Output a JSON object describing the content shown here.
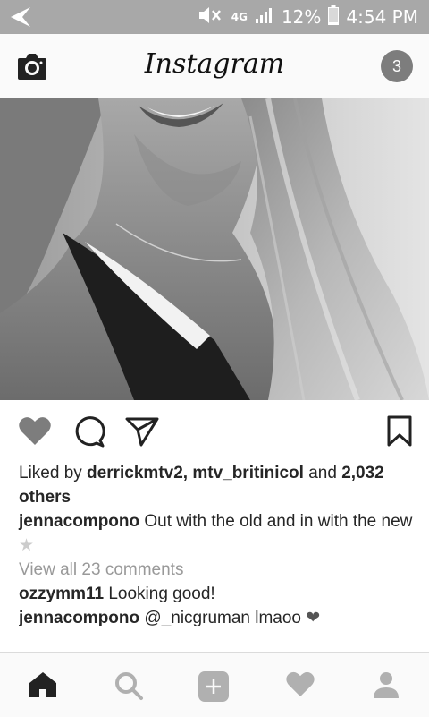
{
  "status_bar": {
    "battery": "12%",
    "time": "4:54 PM",
    "network": "4G",
    "icons": [
      "back-arrow-icon",
      "mute-icon",
      "signal-icon",
      "battery-icon"
    ]
  },
  "app_bar": {
    "logo": "Instagram",
    "notification_count": "3",
    "icons": [
      "camera-icon"
    ]
  },
  "post": {
    "likes": {
      "prefix": "Liked by ",
      "user1": "derrickmtv2",
      "sep": ", ",
      "user2": "mtv_britinicol",
      "and": " and ",
      "count": "2,032",
      "suffix": "others"
    },
    "caption": {
      "user": "jennacompono",
      "text": "Out with the old and in with the new",
      "emoji": "★"
    },
    "view_all": "View all 23 comments",
    "comments": [
      {
        "user": "ozzymm11",
        "text": "Looking good!"
      },
      {
        "user": "jennacompono",
        "text": "@_nicgruman lmaoo",
        "emoji": "❤"
      }
    ],
    "action_icons": [
      "heart-icon",
      "comment-icon",
      "share-icon",
      "bookmark-icon"
    ]
  },
  "bottom_nav": [
    "home-icon",
    "search-icon",
    "add-icon",
    "activity-icon",
    "profile-icon"
  ]
}
